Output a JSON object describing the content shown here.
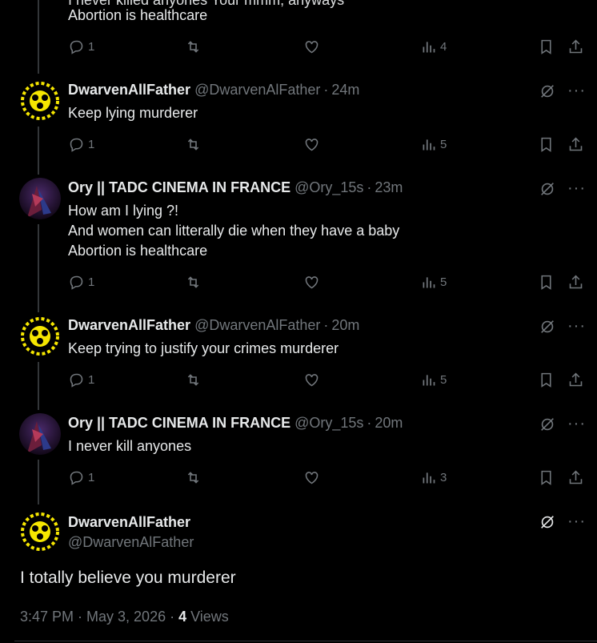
{
  "prev_tweet": {
    "partial_line": "I never killed anyones Your mmm, anyways",
    "line": "Abortion is healthcare",
    "reply_count": "1",
    "view_count": "4"
  },
  "tweets": [
    {
      "name": "DwarvenAllFather",
      "handle": "@DwarvenAlFather",
      "time": "24m",
      "text": "Keep lying murderer",
      "reply_count": "1",
      "view_count": "5"
    },
    {
      "name": "Ory || TADC CINEMA IN FRANCE",
      "handle": "@Ory_15s",
      "time": "23m",
      "text": "How am I lying ?!\nAnd women can litterally die when they have a baby\nAbortion is healthcare",
      "reply_count": "1",
      "view_count": "5"
    },
    {
      "name": "DwarvenAllFather",
      "handle": "@DwarvenAlFather",
      "time": "20m",
      "text": "Keep trying to justify your crimes murderer",
      "reply_count": "1",
      "view_count": "5"
    },
    {
      "name": "Ory || TADC CINEMA IN FRANCE",
      "handle": "@Ory_15s",
      "time": "20m",
      "text": "I never kill anyones",
      "reply_count": "1",
      "view_count": "3"
    }
  ],
  "main_tweet": {
    "name": "DwarvenAllFather",
    "handle": "@DwarvenAlFather",
    "text": "I totally believe you murderer",
    "timestamp": "3:47 PM · May 3, 2026 · ",
    "views_count": "4",
    "views_label": " Views"
  },
  "separator": "·",
  "colors": {
    "background": "#000000",
    "text": "#e7e9ea",
    "muted": "#71767b",
    "dwarven_avatar": "#f5e600"
  },
  "icons": [
    "reply-icon",
    "retweet-icon",
    "like-icon",
    "views-icon",
    "bookmark-icon",
    "share-icon",
    "grok-icon",
    "more-icon"
  ]
}
